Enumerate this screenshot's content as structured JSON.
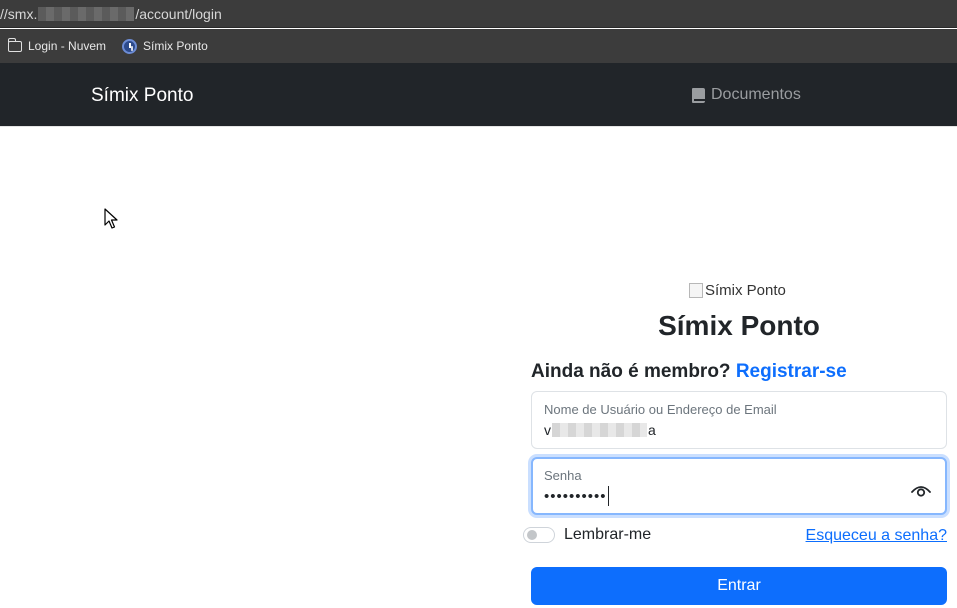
{
  "browser": {
    "url_prefix": "//smx.",
    "url_suffix": "/account/login",
    "bookmarks": [
      {
        "label": "Login - Nuvem",
        "icon": "folder-icon"
      },
      {
        "label": "Símix Ponto",
        "icon": "clock-badge-icon"
      }
    ]
  },
  "navbar": {
    "brand": "Símix Ponto",
    "docs_label": "Documentos",
    "docs_icon": "book-icon"
  },
  "login": {
    "logo_alt": "Símix Ponto",
    "title": "Símix Ponto",
    "member_question": "Ainda não é membro?",
    "register_link": "Registrar-se",
    "username": {
      "label": "Nome de Usuário ou Endereço de Email",
      "value_start": "v",
      "value_end": "a"
    },
    "password": {
      "label": "Senha",
      "value": "••••••••••"
    },
    "remember_label": "Lembrar-me",
    "forgot_link": "Esqueceu a senha?",
    "submit_label": "Entrar"
  },
  "colors": {
    "navbar_bg": "#212529",
    "primary": "#0d6efd",
    "browser_bg": "#3c3c3c"
  }
}
